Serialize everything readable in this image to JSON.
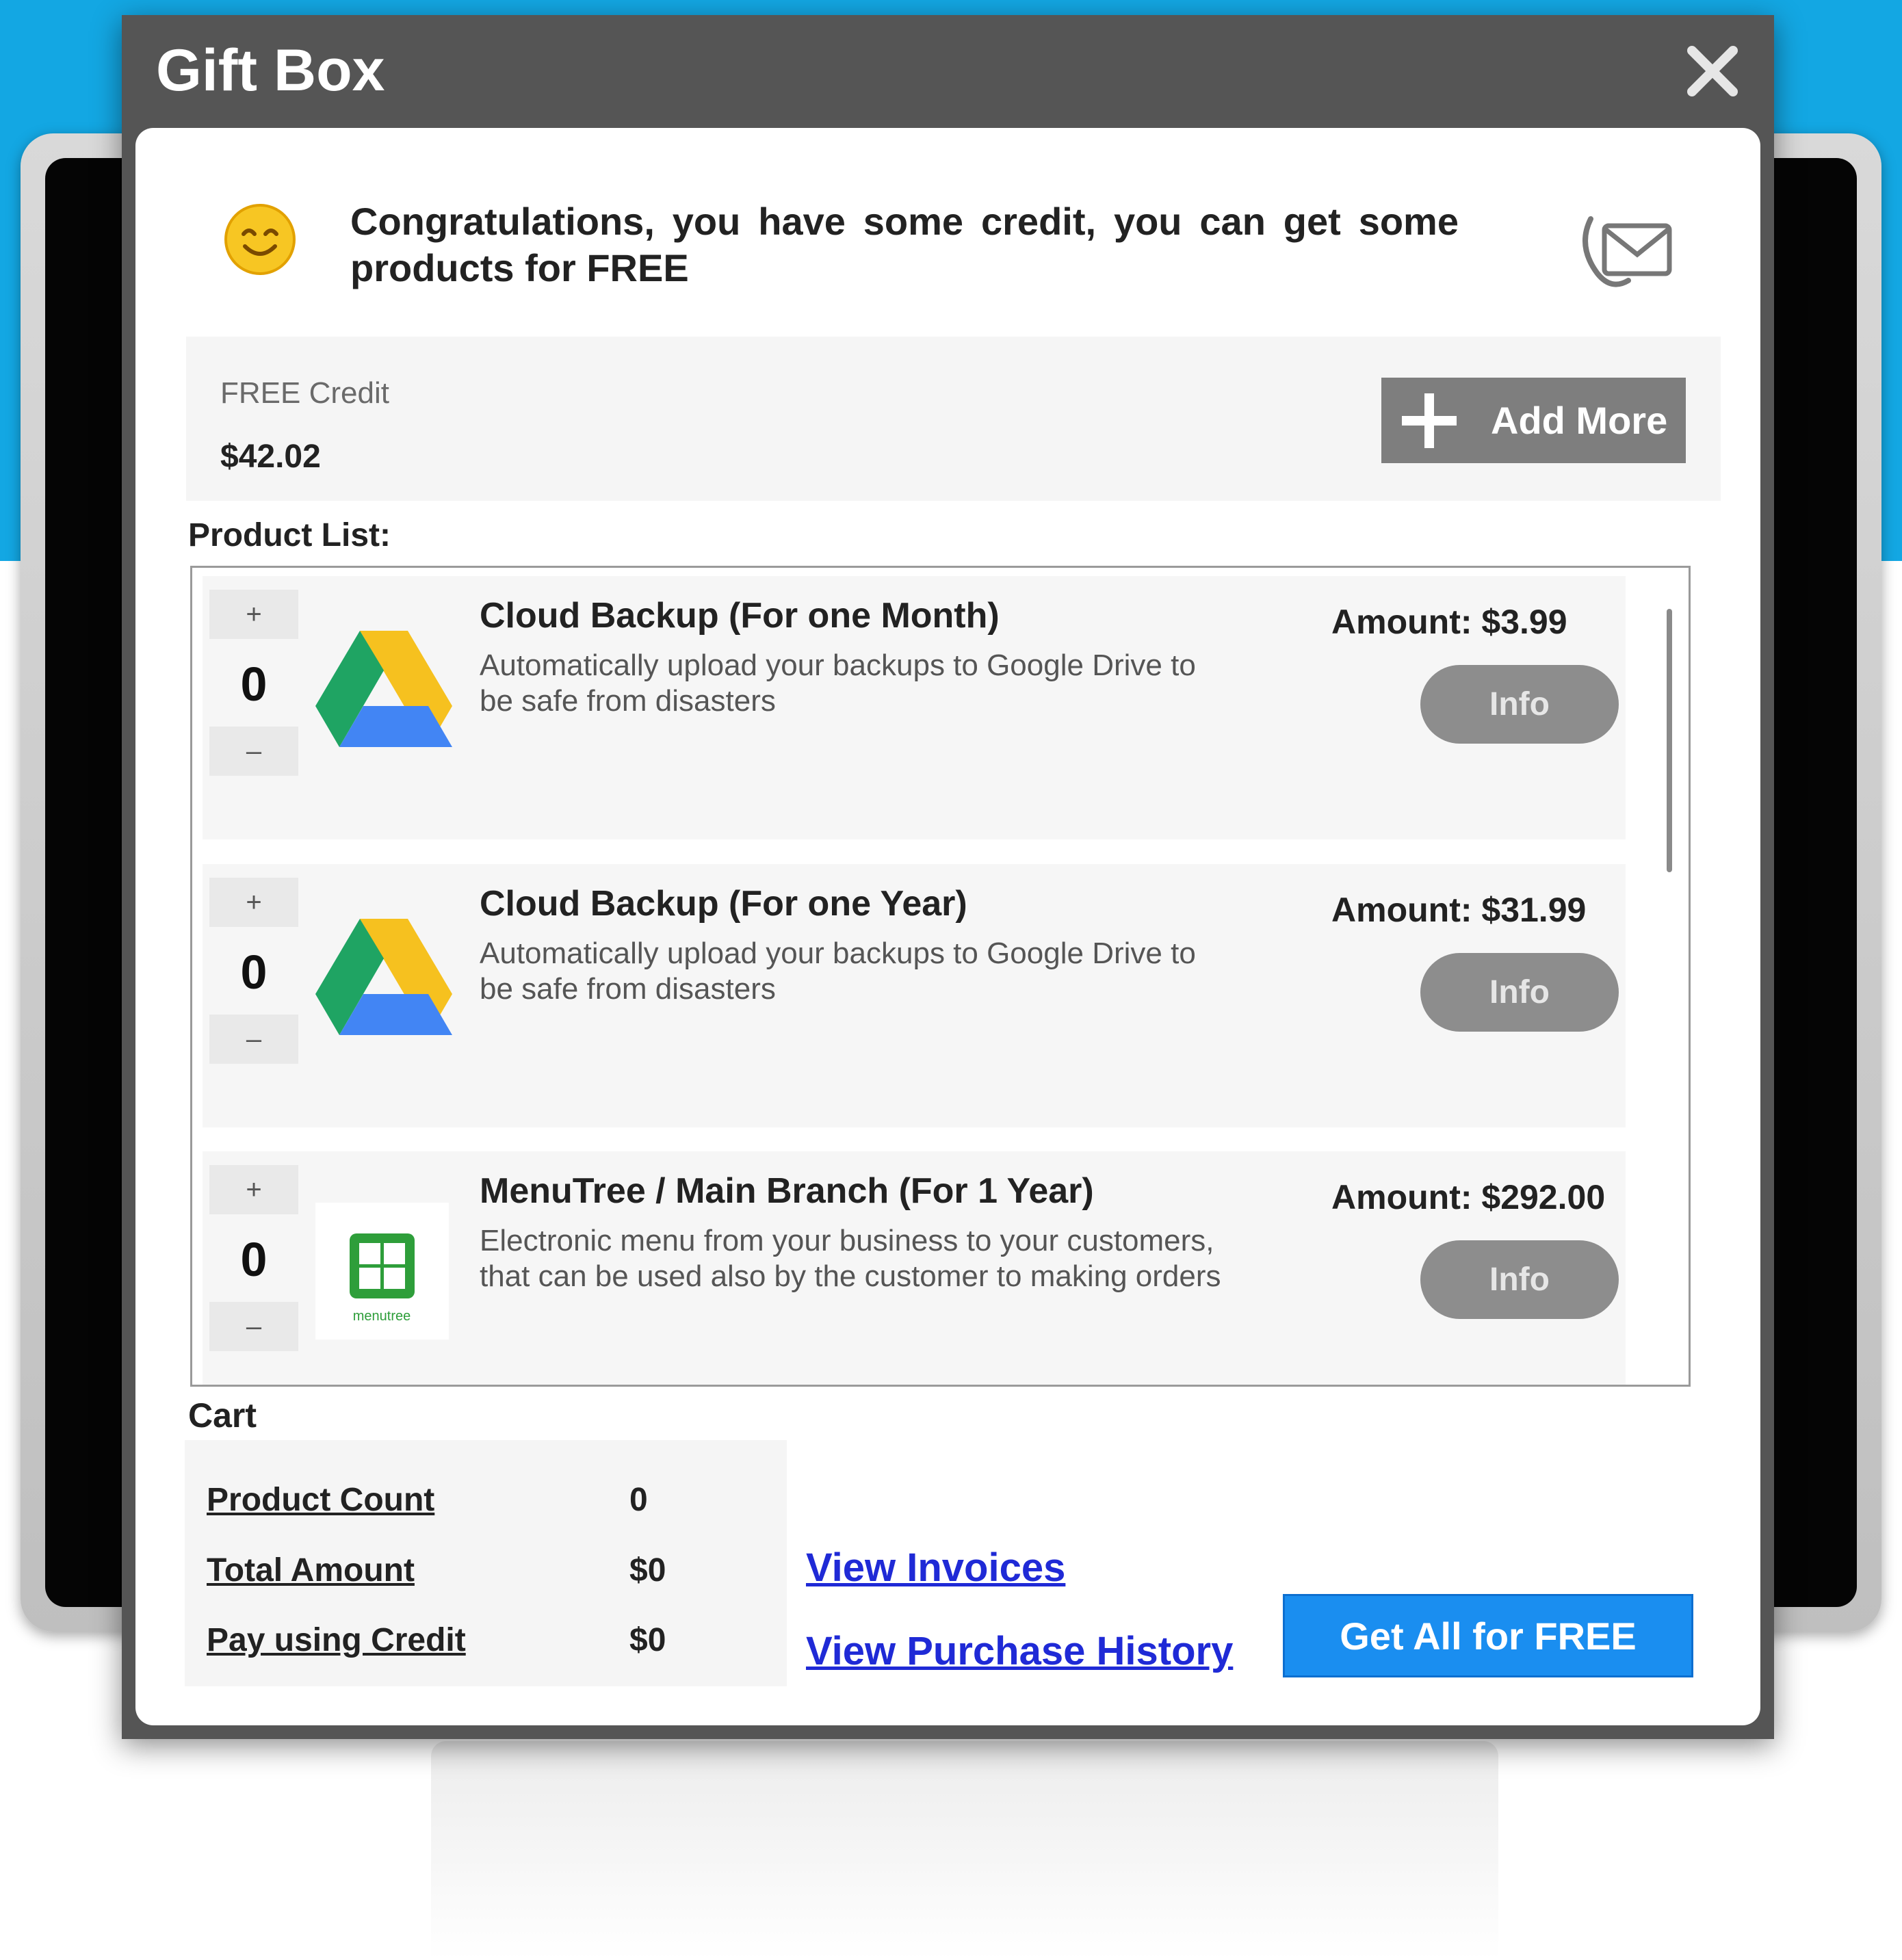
{
  "dialog": {
    "title": "Gift Box",
    "close_icon": "close-icon",
    "congrats_text": "Congratulations, you have some credit, you can get some products for FREE",
    "smiley_icon": "smiley-icon",
    "contact_icon": "mail-phone-icon"
  },
  "credit": {
    "label": "FREE Credit",
    "value": "$42.02",
    "add_more_label": "Add More",
    "add_more_icon": "plus-icon"
  },
  "product_list": {
    "label": "Product List:",
    "items": [
      {
        "name": "Cloud Backup (For one Month)",
        "description": "Automatically upload your backups to Google Drive to be safe from disasters",
        "amount": "Amount: $3.99",
        "quantity": "0",
        "plus": "+",
        "minus": "–",
        "info_label": "Info",
        "icon": "google-drive-icon"
      },
      {
        "name": "Cloud Backup (For one Year)",
        "description": "Automatically upload your backups to Google Drive to be safe from disasters",
        "amount": "Amount: $31.99",
        "quantity": "0",
        "plus": "+",
        "minus": "–",
        "info_label": "Info",
        "icon": "google-drive-icon"
      },
      {
        "name": "MenuTree / Main Branch (For 1 Year)",
        "description": "Electronic menu from your business to your customers, that can be used also by the customer to making orders",
        "amount": "Amount: $292.00",
        "quantity": "0",
        "plus": "+",
        "minus": "–",
        "info_label": "Info",
        "icon": "menutree-icon",
        "icon_caption": "menutree"
      }
    ]
  },
  "cart": {
    "label": "Cart",
    "product_count_label": "Product Count",
    "product_count": "0",
    "total_amount_label": "Total Amount",
    "total_amount": "$0",
    "pay_credit_label": "Pay using Credit",
    "pay_credit": "$0"
  },
  "links": {
    "view_invoices": "View Invoices",
    "view_history": "View Purchase History"
  },
  "actions": {
    "get_free_label": "Get All for FREE"
  },
  "colors": {
    "background_blue": "#13a7e3",
    "titlebar": "#555555",
    "accent_button": "#1a8ef0",
    "link": "#1f2ad6",
    "neutral_button": "#7e7e7e"
  }
}
